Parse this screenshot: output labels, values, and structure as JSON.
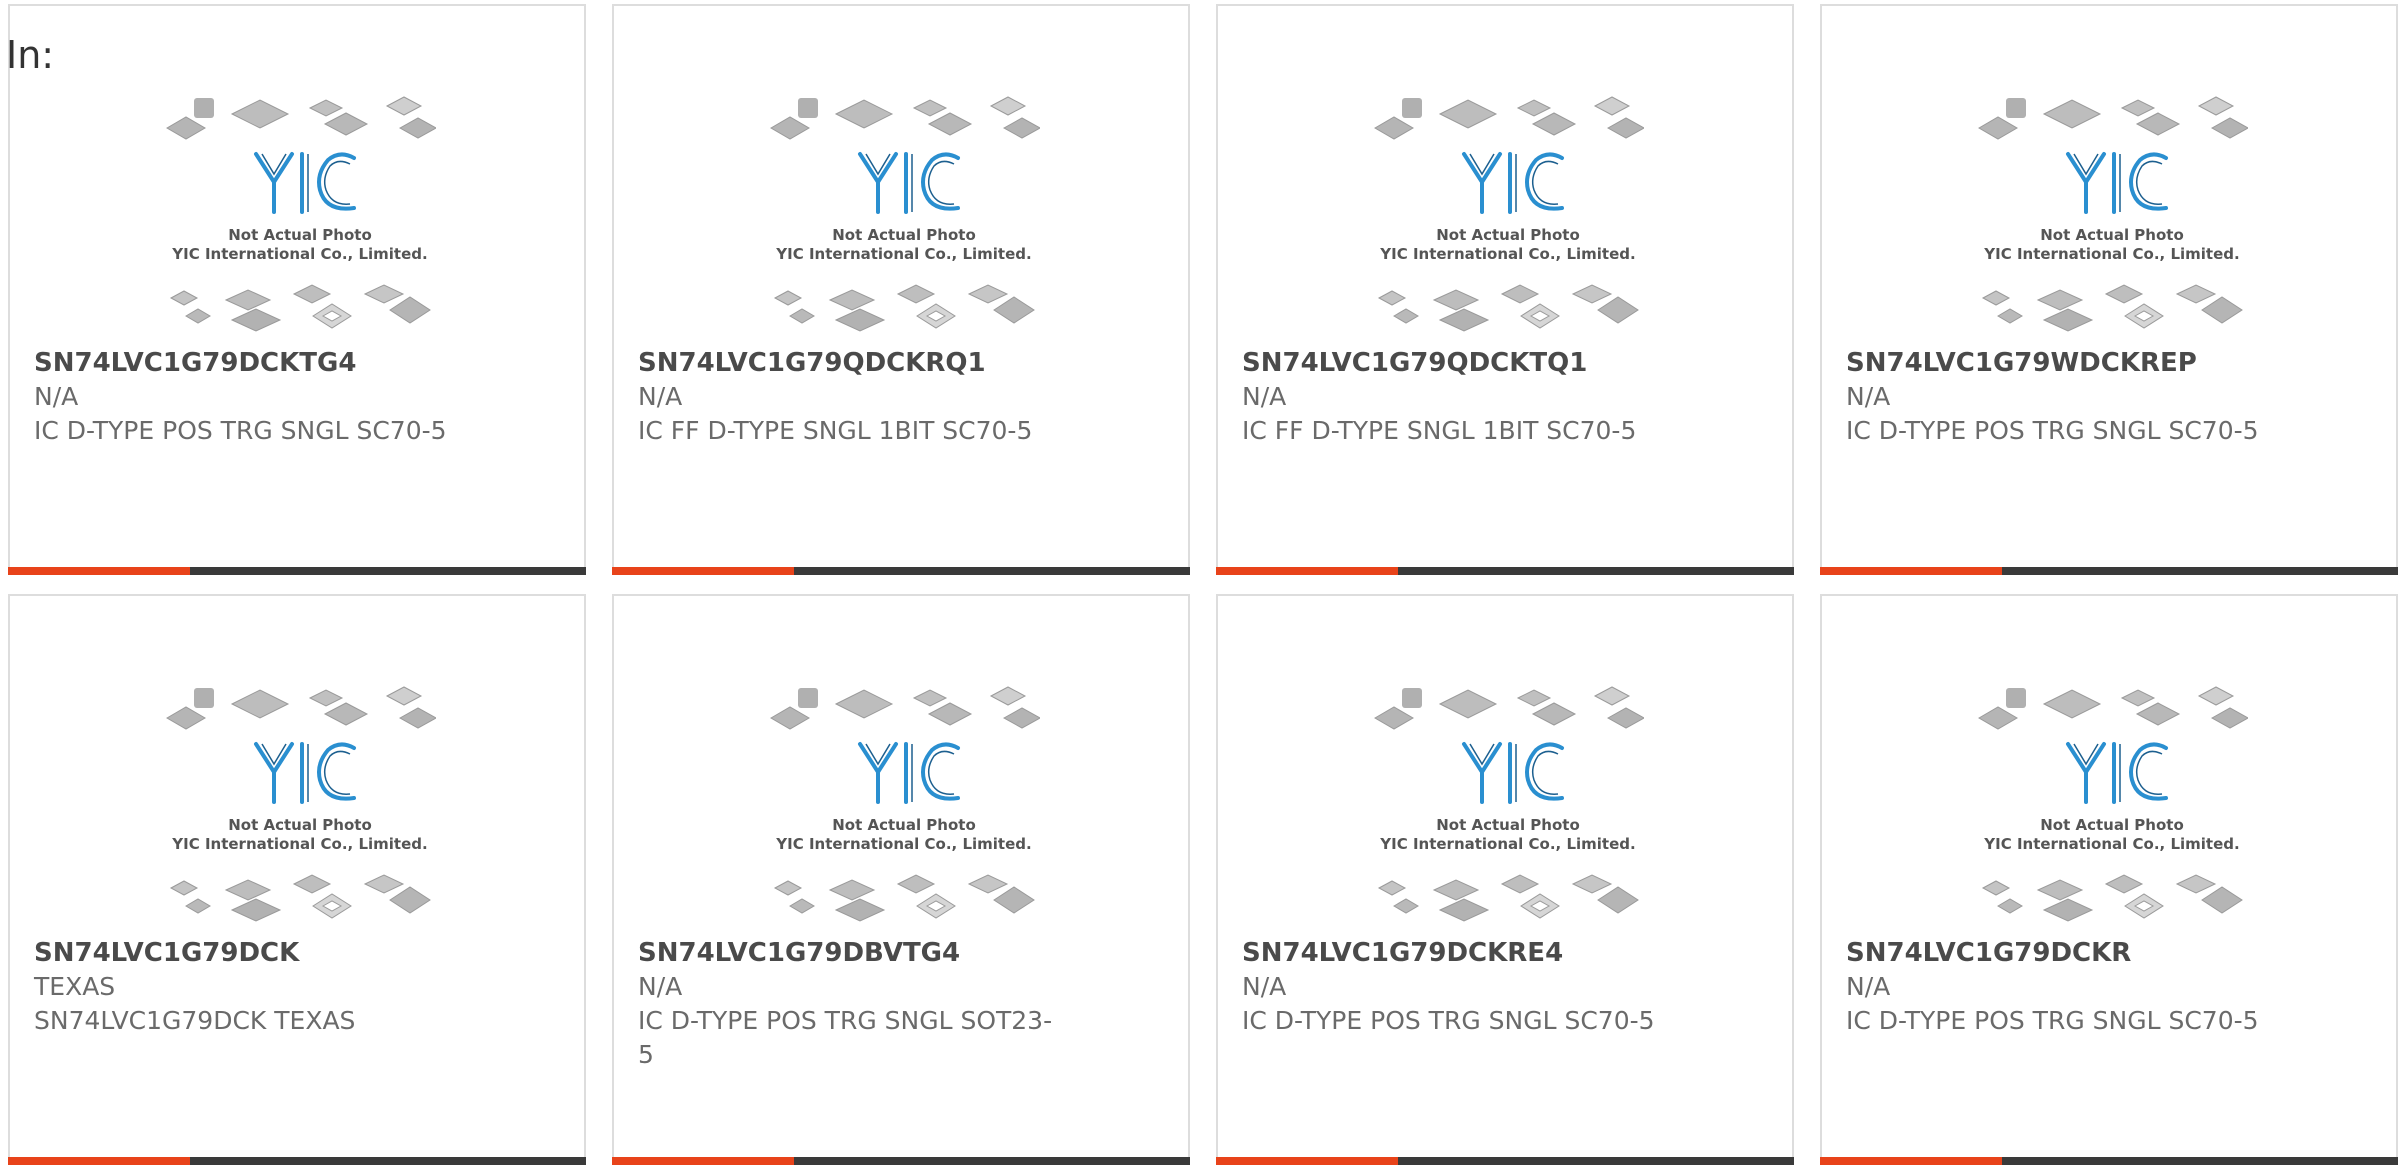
{
  "prefix_label": "In:",
  "photo": {
    "line1": "Not Actual Photo",
    "line2": "YIC International Co., Limited.",
    "logo": "YIC"
  },
  "colors": {
    "accent": "#e8431a",
    "bar_dark": "#3a3a3a",
    "logo_blue": "#2a8fd0"
  },
  "products": [
    {
      "part": "SN74LVC1G79DCKTG4",
      "manufacturer": "N/A",
      "description": "IC D-TYPE POS TRG SNGL SC70-5"
    },
    {
      "part": "SN74LVC1G79QDCKRQ1",
      "manufacturer": "N/A",
      "description": "IC FF D-TYPE SNGL 1BIT SC70-5"
    },
    {
      "part": "SN74LVC1G79QDCKTQ1",
      "manufacturer": "N/A",
      "description": "IC FF D-TYPE SNGL 1BIT SC70-5"
    },
    {
      "part": "SN74LVC1G79WDCKREP",
      "manufacturer": "N/A",
      "description": "IC D-TYPE POS TRG SNGL SC70-5"
    },
    {
      "part": "SN74LVC1G79DCK",
      "manufacturer": "TEXAS",
      "description": "SN74LVC1G79DCK TEXAS"
    },
    {
      "part": "SN74LVC1G79DBVTG4",
      "manufacturer": "N/A",
      "description": "IC D-TYPE POS TRG SNGL SOT23-5"
    },
    {
      "part": "SN74LVC1G79DCKRE4",
      "manufacturer": "N/A",
      "description": "IC D-TYPE POS TRG SNGL SC70-5"
    },
    {
      "part": "SN74LVC1G79DCKR",
      "manufacturer": "N/A",
      "description": "IC D-TYPE POS TRG SNGL SC70-5"
    }
  ]
}
